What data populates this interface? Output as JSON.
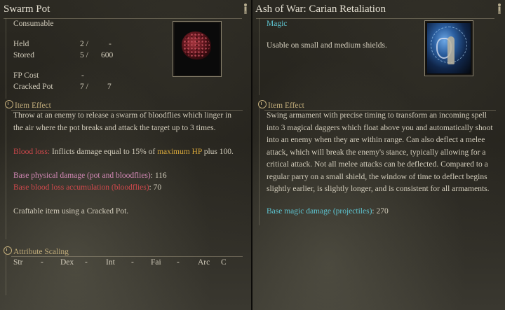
{
  "left": {
    "title": "Swarm Pot",
    "category": "Consumable",
    "stats": [
      {
        "label": "Held",
        "v1": "2 /",
        "v2": "-"
      },
      {
        "label": "Stored",
        "v1": "5 /",
        "v2": "600"
      },
      {
        "label": "FP Cost",
        "v1": "-",
        "v2": ""
      },
      {
        "label": "Cracked Pot",
        "v1": "7 /",
        "v2": "7"
      }
    ],
    "effect_heading": "Item Effect",
    "description": [
      "Throw at an enemy to release a swarm of bloodflies which linger in",
      "the air where the pot breaks and attack the target up to 3 times."
    ],
    "blood_loss_label": "Blood loss:",
    "blood_loss_text_a": " Inflicts damage equal to 15% of ",
    "blood_loss_highlight": "maximum HP",
    "blood_loss_text_b": " plus 100.",
    "base_physical_label": "Base physical damage (pot and bloodflies)",
    "base_physical_value": ": 116",
    "base_blood_label": "Base blood loss accumulation (bloodflies)",
    "base_blood_value": ": 70",
    "craft_text": "Craftable item using a Cracked Pot.",
    "scaling_heading": "Attribute Scaling",
    "scaling": [
      {
        "attr": "Str",
        "val": "-"
      },
      {
        "attr": "Dex",
        "val": "-"
      },
      {
        "attr": "Int",
        "val": "-"
      },
      {
        "attr": "Fai",
        "val": "-"
      },
      {
        "attr": "Arc",
        "val": "C"
      }
    ]
  },
  "right": {
    "title": "Ash of War: Carian Retaliation",
    "affinity": "Magic",
    "usable_text": "Usable on small and medium shields.",
    "effect_heading": "Item Effect",
    "description": [
      "Swing armament with precise timing to transform an incoming spell",
      "into 3 magical daggers which float above you and automatically shoot",
      "into an enemy when they are within range. Can also deflect a melee",
      "attack, which will break the enemy's stance, typically allowing for a",
      "critical attack. Not all melee attacks can be deflected. Compared to a",
      "regular parry on a small shield, the window of time to deflect begins",
      "slightly earlier, is slightly longer, and is consistent for all armaments."
    ],
    "base_magic_label": "Base magic damage (projectiles)",
    "base_magic_value": ": 270"
  },
  "colors": {
    "blood": "#d0484c",
    "highlight": "#d6a63a",
    "physical": "#d68ab8",
    "magic": "#5ec4d0",
    "heading": "#c2ad7b"
  },
  "icons": [
    "person-icon",
    "item-effect-icon",
    "attribute-scaling-icon",
    "swarm-pot-image",
    "carian-retaliation-image"
  ]
}
